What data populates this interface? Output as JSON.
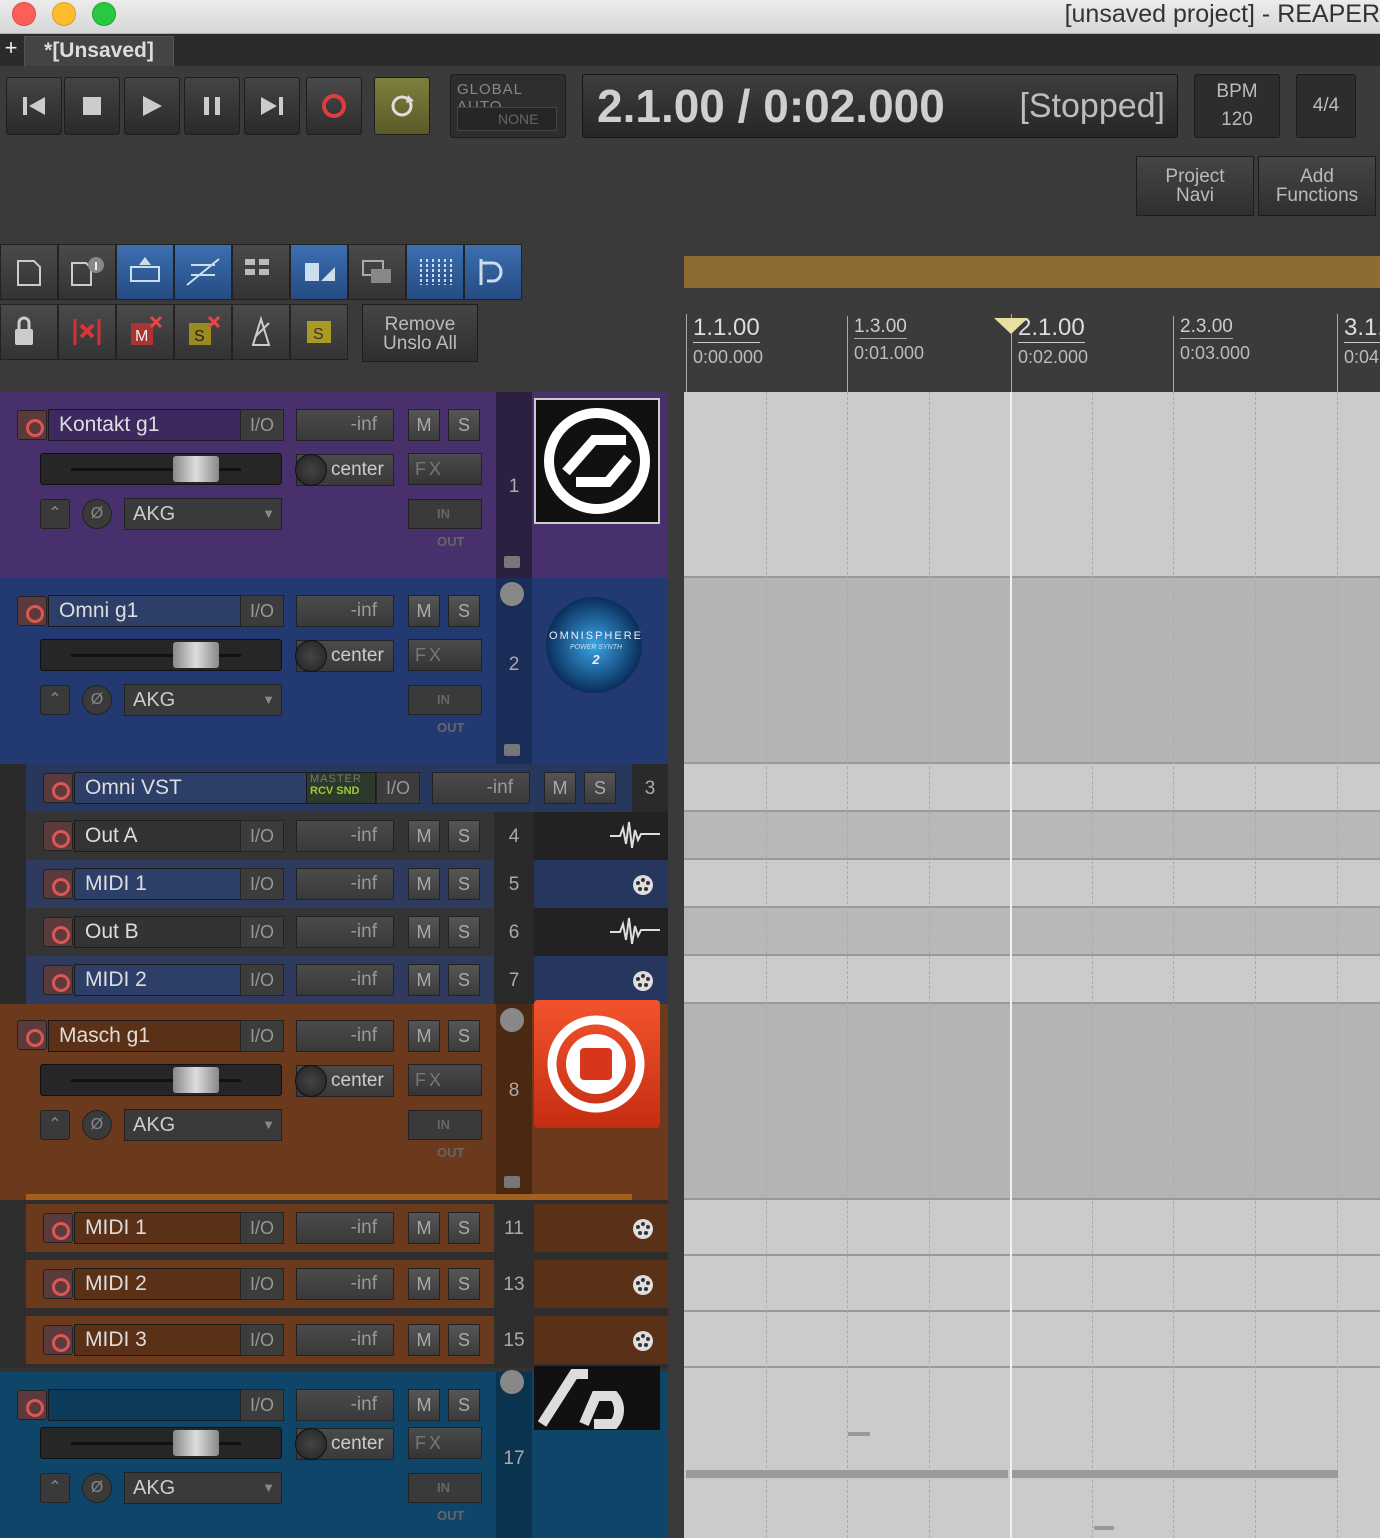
{
  "window": {
    "title": "[unsaved project] - REAPER"
  },
  "tabs": [
    {
      "label": "*[Unsaved]"
    }
  ],
  "transport": {
    "global_auto_label": "GLOBAL AUTO",
    "global_auto_value": "NONE",
    "position": "2.1.00 / 0:02.000",
    "state": "[Stopped]",
    "bpm_label": "BPM",
    "bpm_value": "120",
    "time_signature": "4/4"
  },
  "right_buttons": {
    "project_navi": "Project\nNavi",
    "add_functions": "Add\nFunctions"
  },
  "toolbar": {
    "remove_unslo": "Remove\nUnslo All"
  },
  "ruler": [
    {
      "bar": "1.1.00",
      "time": "0:00.000",
      "major": true
    },
    {
      "bar": "1.3.00",
      "time": "0:01.000",
      "major": false
    },
    {
      "bar": "2.1.00",
      "time": "0:02.000",
      "major": true
    },
    {
      "bar": "2.3.00",
      "time": "0:03.000",
      "major": false
    },
    {
      "bar": "3.1.",
      "time": "0:04",
      "major": true
    }
  ],
  "tracks": [
    {
      "name": "Kontakt g1",
      "number": "1",
      "vol": "-inf",
      "pan": "center",
      "preset": "AKG",
      "fx": "FX",
      "io": "I/O",
      "m": "M",
      "s": "S",
      "inout": "IN OUT"
    },
    {
      "name": "Omni g1",
      "number": "2",
      "vol": "-inf",
      "pan": "center",
      "preset": "AKG",
      "fx": "FX",
      "io": "I/O",
      "m": "M",
      "s": "S",
      "inout": "IN OUT",
      "logo_text": "OMNISPHERE",
      "logo_sub": "POWER SYNTH",
      "logo_num": "2"
    },
    {
      "name": "Omni VST",
      "number": "3",
      "vol": "-inf",
      "io": "I/O",
      "m": "M",
      "s": "S",
      "master": "MASTER",
      "rcv": "RCV SND"
    },
    {
      "name": "Out A",
      "number": "4",
      "vol": "-inf",
      "io": "I/O",
      "m": "M",
      "s": "S"
    },
    {
      "name": "MIDI 1",
      "number": "5",
      "vol": "-inf",
      "io": "I/O",
      "m": "M",
      "s": "S"
    },
    {
      "name": "Out B",
      "number": "6",
      "vol": "-inf",
      "io": "I/O",
      "m": "M",
      "s": "S"
    },
    {
      "name": "MIDI 2",
      "number": "7",
      "vol": "-inf",
      "io": "I/O",
      "m": "M",
      "s": "S"
    },
    {
      "name": "Masch g1",
      "number": "8",
      "vol": "-inf",
      "pan": "center",
      "preset": "AKG",
      "fx": "FX",
      "io": "I/O",
      "m": "M",
      "s": "S",
      "inout": "IN OUT"
    },
    {
      "name": "MIDI 1",
      "number": "11",
      "vol": "-inf",
      "io": "I/O",
      "m": "M",
      "s": "S"
    },
    {
      "name": "MIDI 2",
      "number": "13",
      "vol": "-inf",
      "io": "I/O",
      "m": "M",
      "s": "S"
    },
    {
      "name": "MIDI 3",
      "number": "15",
      "vol": "-inf",
      "io": "I/O",
      "m": "M",
      "s": "S"
    },
    {
      "name": "",
      "number": "17",
      "vol": "-inf",
      "pan": "center",
      "preset": "AKG",
      "fx": "FX",
      "io": "I/O",
      "m": "M",
      "s": "S",
      "inout": "IN OUT"
    }
  ],
  "colors": {
    "purple": "#4a2e6e",
    "blue": "#233b72",
    "brown": "#6b3a1c",
    "teal": "#0d4466",
    "ruler_band": "#8e6a35",
    "record": "#d83a3a",
    "loop": "#7a7a36"
  }
}
